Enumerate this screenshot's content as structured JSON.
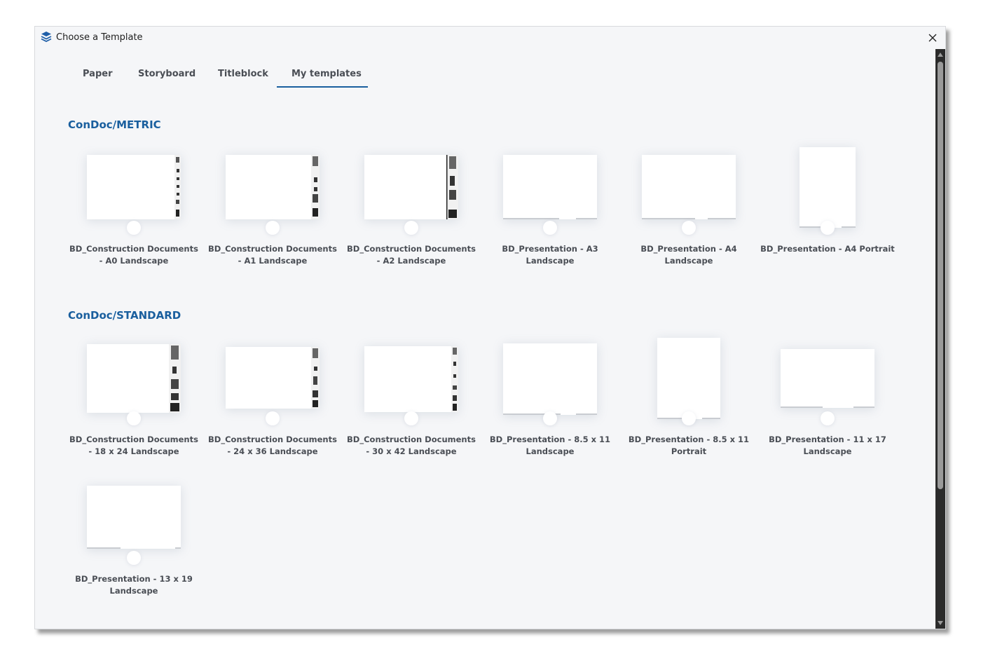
{
  "window": {
    "title": "Choose a Template"
  },
  "tabs": [
    {
      "label": "Paper"
    },
    {
      "label": "Storyboard"
    },
    {
      "label": "Titleblock"
    },
    {
      "label": "My templates"
    }
  ],
  "active_tab": "My templates",
  "sections": [
    {
      "title": "ConDoc/METRIC",
      "templates": [
        {
          "line1": "BD_Construction Documents",
          "line2": "- A0 Landscape"
        },
        {
          "line1": "BD_Construction Documents",
          "line2": "- A1 Landscape"
        },
        {
          "line1": "BD_Construction Documents",
          "line2": "- A2 Landscape"
        },
        {
          "line1": "BD_Presentation - A3",
          "line2": "Landscape"
        },
        {
          "line1": "BD_Presentation - A4",
          "line2": "Landscape"
        },
        {
          "line1": "BD_Presentation - A4 Portrait",
          "line2": ""
        }
      ]
    },
    {
      "title": "ConDoc/STANDARD",
      "templates": [
        {
          "line1": "BD_Construction Documents",
          "line2": "- 18 x 24 Landscape"
        },
        {
          "line1": "BD_Construction Documents",
          "line2": "- 24 x 36 Landscape"
        },
        {
          "line1": "BD_Construction Documents",
          "line2": "- 30 x 42 Landscape"
        },
        {
          "line1": "BD_Presentation - 8.5 x 11",
          "line2": "Landscape"
        },
        {
          "line1": "BD_Presentation - 8.5 x 11",
          "line2": "Portrait"
        },
        {
          "line1": "BD_Presentation - 11 x 17",
          "line2": "Landscape"
        },
        {
          "line1": "BD_Presentation - 13 x 19",
          "line2": "Landscape"
        }
      ]
    }
  ],
  "colors": {
    "accent": "#1a5f9e",
    "text": "#4a4e55",
    "background": "#f5f6f8"
  },
  "icons": {
    "app": "layers-icon",
    "close": "close-icon"
  }
}
